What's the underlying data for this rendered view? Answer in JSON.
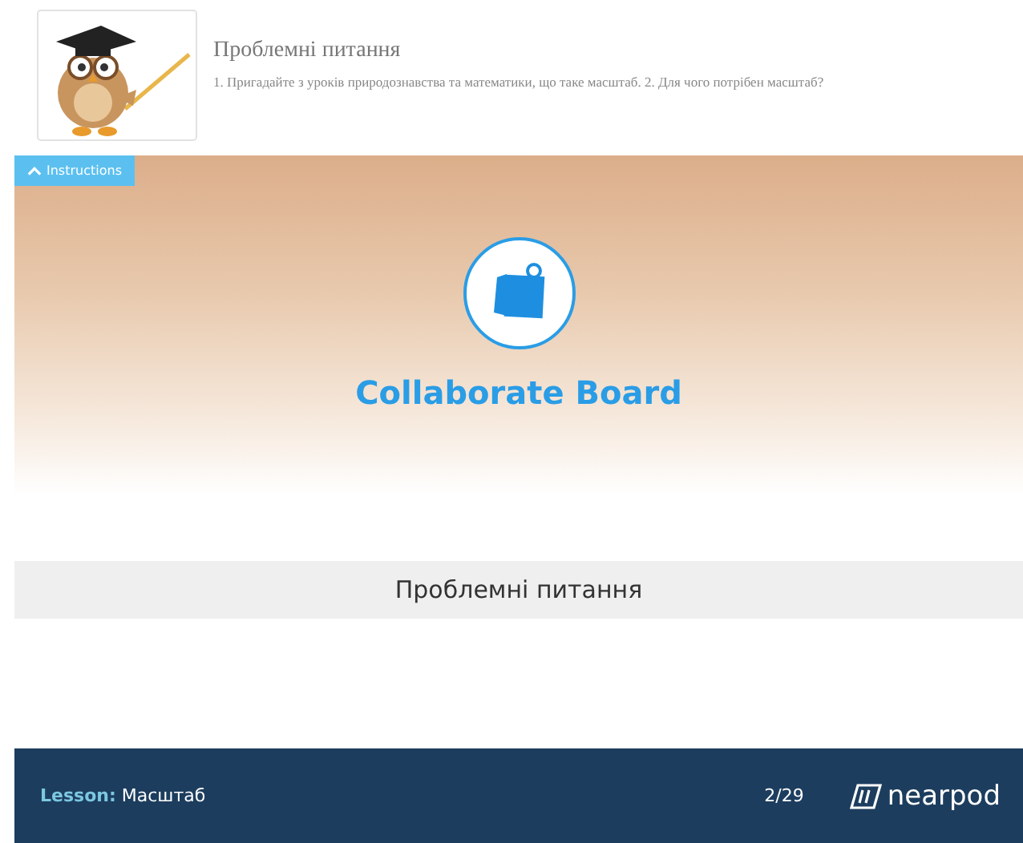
{
  "header": {
    "title": "Проблемні питання",
    "description": "1. Пригадайте з уроків природознавства та математики, що таке масштаб. 2. Для чого потрібен масштаб?"
  },
  "instructions_toggle": {
    "label": "Instructions",
    "expanded": true
  },
  "board": {
    "title": "Collaborate Board",
    "question": "Проблемні питання"
  },
  "footer": {
    "lesson_label": "Lesson:",
    "lesson_name": "Масштаб",
    "page": "2/29",
    "brand": "nearpod"
  }
}
